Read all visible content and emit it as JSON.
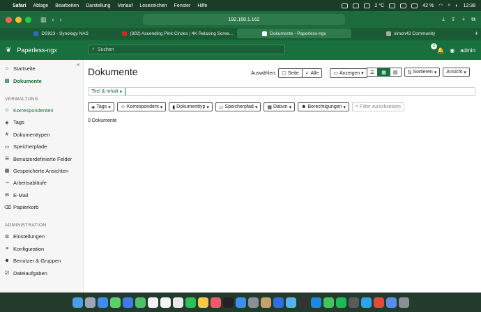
{
  "menubar": {
    "app": "Safari",
    "items": [
      "Ablage",
      "Bearbeiten",
      "Darstellung",
      "Verlauf",
      "Lesezeichen",
      "Fenster",
      "Hilfe"
    ],
    "weather": "2 °C",
    "battery": "42 %",
    "time": "12:38"
  },
  "toolbar": {
    "address": "192.168.1.162"
  },
  "tabs": [
    {
      "label": "DS923 - Synology NAS",
      "color": "#2d6cc0"
    },
    {
      "label": "(302) Ascending Pink Circles | 4K Relaxing Scree...",
      "color": "#d22"
    },
    {
      "label": "Dokumente - Paperless-ngx",
      "color": "#fff"
    },
    {
      "label": "simon42 Community",
      "color": "#aaa"
    }
  ],
  "appbar": {
    "brand": "Paperless-ngx",
    "search_placeholder": "Suchen",
    "notifications": "2",
    "user": "admin"
  },
  "sidebar": {
    "top": [
      {
        "label": "Startseite",
        "icon": "home-icon",
        "glyph": "⌂"
      },
      {
        "label": "Dokumente",
        "icon": "documents-icon",
        "glyph": "▤",
        "active": true
      }
    ],
    "verwaltung_header": "VERWALTUNG",
    "verwaltung": [
      {
        "label": "Korrespondenten",
        "icon": "person-icon",
        "glyph": "☺"
      },
      {
        "label": "Tags",
        "icon": "tag-icon",
        "glyph": "◈"
      },
      {
        "label": "Dokumenttypen",
        "icon": "hash-icon",
        "glyph": "#"
      },
      {
        "label": "Speicherpfade",
        "icon": "folder-icon",
        "glyph": "▭"
      },
      {
        "label": "Benutzerdefinierte Felder",
        "icon": "ui-radios-icon",
        "glyph": "☰"
      },
      {
        "label": "Gespeicherte Ansichten",
        "icon": "saved-views-icon",
        "glyph": "▦"
      },
      {
        "label": "Arbeitsabläufe",
        "icon": "workflow-icon",
        "glyph": "⤳"
      },
      {
        "label": "E-Mail",
        "icon": "mail-icon",
        "glyph": "✉"
      },
      {
        "label": "Papierkorb",
        "icon": "trash-icon",
        "glyph": "🗑"
      }
    ],
    "administration_header": "ADMINISTRATION",
    "administration": [
      {
        "label": "Einstellungen",
        "icon": "gear-icon",
        "glyph": "⚙"
      },
      {
        "label": "Konfiguration",
        "icon": "sliders-icon",
        "glyph": "≡"
      },
      {
        "label": "Benutzer & Gruppen",
        "icon": "people-icon",
        "glyph": "☻"
      },
      {
        "label": "Dateiaufgaben",
        "icon": "file-tasks-icon",
        "glyph": "☑"
      }
    ]
  },
  "main": {
    "title": "Dokumente",
    "select_label": "Auswählen:",
    "select_page": "Seite",
    "select_all": "Alle",
    "show": "Anzeigen",
    "sort": "Sortieren",
    "view": "Ansicht",
    "title_content": "Titel & Inhalt",
    "filters": [
      "Tags",
      "Korrespondent",
      "Dokumenttyp",
      "Speicherpfad",
      "Datum",
      "Berechtigungen"
    ],
    "reset": "Filter zurücksetzen",
    "count": "0 Dokumente"
  }
}
